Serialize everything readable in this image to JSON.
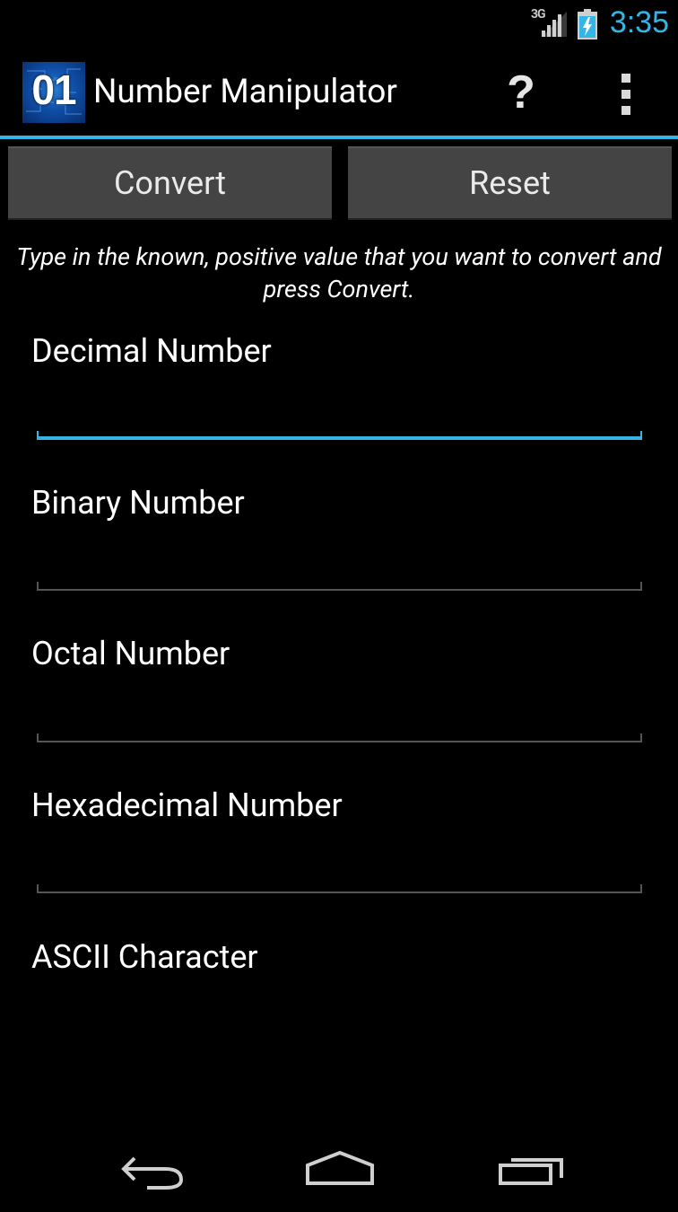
{
  "status_bar": {
    "network": "3G",
    "time": "3:35",
    "icons": [
      "signal-icon",
      "battery-charging-icon"
    ],
    "accent_color": "#33b5e5"
  },
  "action_bar": {
    "logo_text": "01",
    "title": "Number Manipulator",
    "help_label": "?",
    "icons": [
      "app-logo-icon",
      "help-icon",
      "overflow-menu-icon"
    ]
  },
  "buttons": {
    "convert": "Convert",
    "reset": "Reset"
  },
  "instructions": "Type in the known, positive value that you want to convert and press Convert.",
  "fields": [
    {
      "label": "Decimal Number",
      "value": "",
      "focused": true
    },
    {
      "label": "Binary Number",
      "value": "",
      "focused": false
    },
    {
      "label": "Octal Number",
      "value": "",
      "focused": false
    },
    {
      "label": "Hexadecimal Number",
      "value": "",
      "focused": false
    },
    {
      "label": "ASCII Character",
      "value": "",
      "focused": false
    }
  ],
  "nav_bar": {
    "icons": [
      "back-icon",
      "home-icon",
      "recent-apps-icon"
    ]
  },
  "colors": {
    "background": "#000000",
    "accent": "#33b5e5",
    "button": "#444444"
  }
}
